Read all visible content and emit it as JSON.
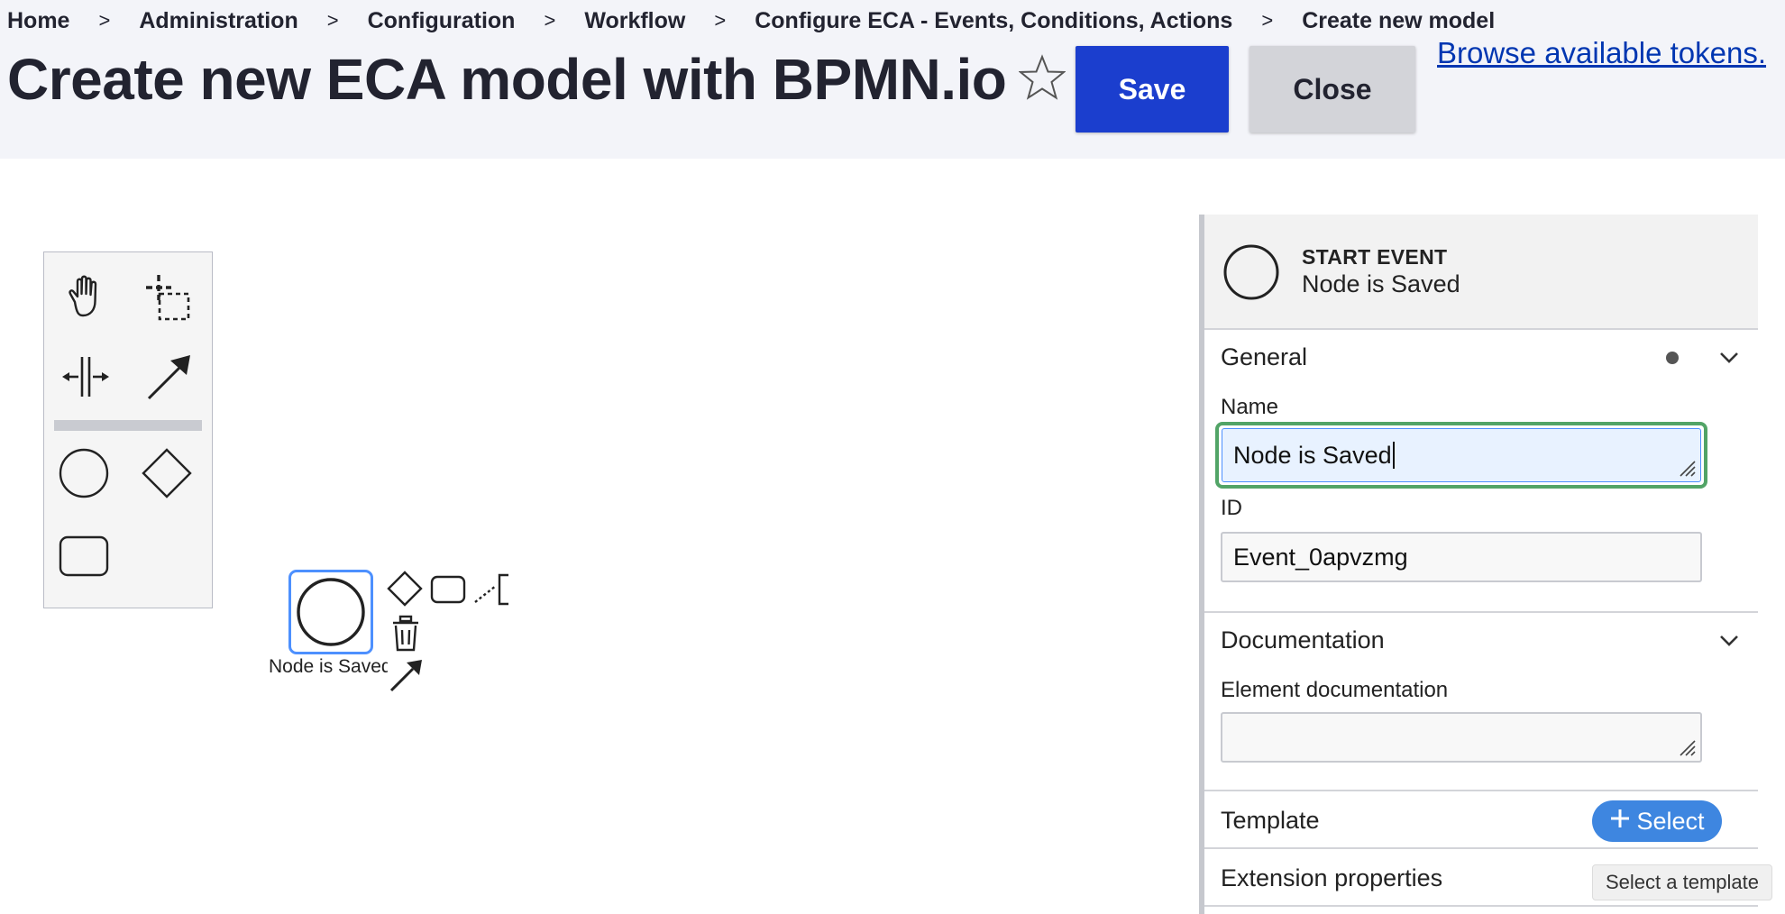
{
  "breadcrumb": {
    "items": [
      "Home",
      "Administration",
      "Configuration",
      "Workflow",
      "Configure ECA - Events, Conditions, Actions"
    ],
    "current": "Create new model",
    "separator": ">"
  },
  "header": {
    "title": "Create new ECA model with BPMN.io",
    "save_label": "Save",
    "close_label": "Close",
    "tokens_link": "Browse available tokens."
  },
  "palette": {
    "tools": [
      "hand-tool",
      "lasso-tool",
      "space-tool",
      "global-connect-tool",
      "create-start-event",
      "create-gateway",
      "create-task"
    ]
  },
  "canvas": {
    "start_event_label": "Node is Saved",
    "selected": true
  },
  "properties": {
    "element_type": "START EVENT",
    "element_name": "Node is Saved",
    "general": {
      "title": "General",
      "name_label": "Name",
      "name_value": "Node is Saved",
      "id_label": "ID",
      "id_value": "Event_0apvzmg"
    },
    "documentation": {
      "title": "Documentation",
      "element_doc_label": "Element documentation",
      "element_doc_value": ""
    },
    "template": {
      "title": "Template",
      "select_label": "Select",
      "tooltip": "Select a template"
    },
    "extension": {
      "title": "Extension properties"
    }
  },
  "colors": {
    "primary_button": "#1b3ece",
    "secondary_button": "#d3d4d9",
    "link": "#0036b1",
    "selection": "#4d90fe",
    "focus_ring": "#52a467",
    "select_button": "#3e86e0",
    "header_bg": "#f3f4f9"
  }
}
